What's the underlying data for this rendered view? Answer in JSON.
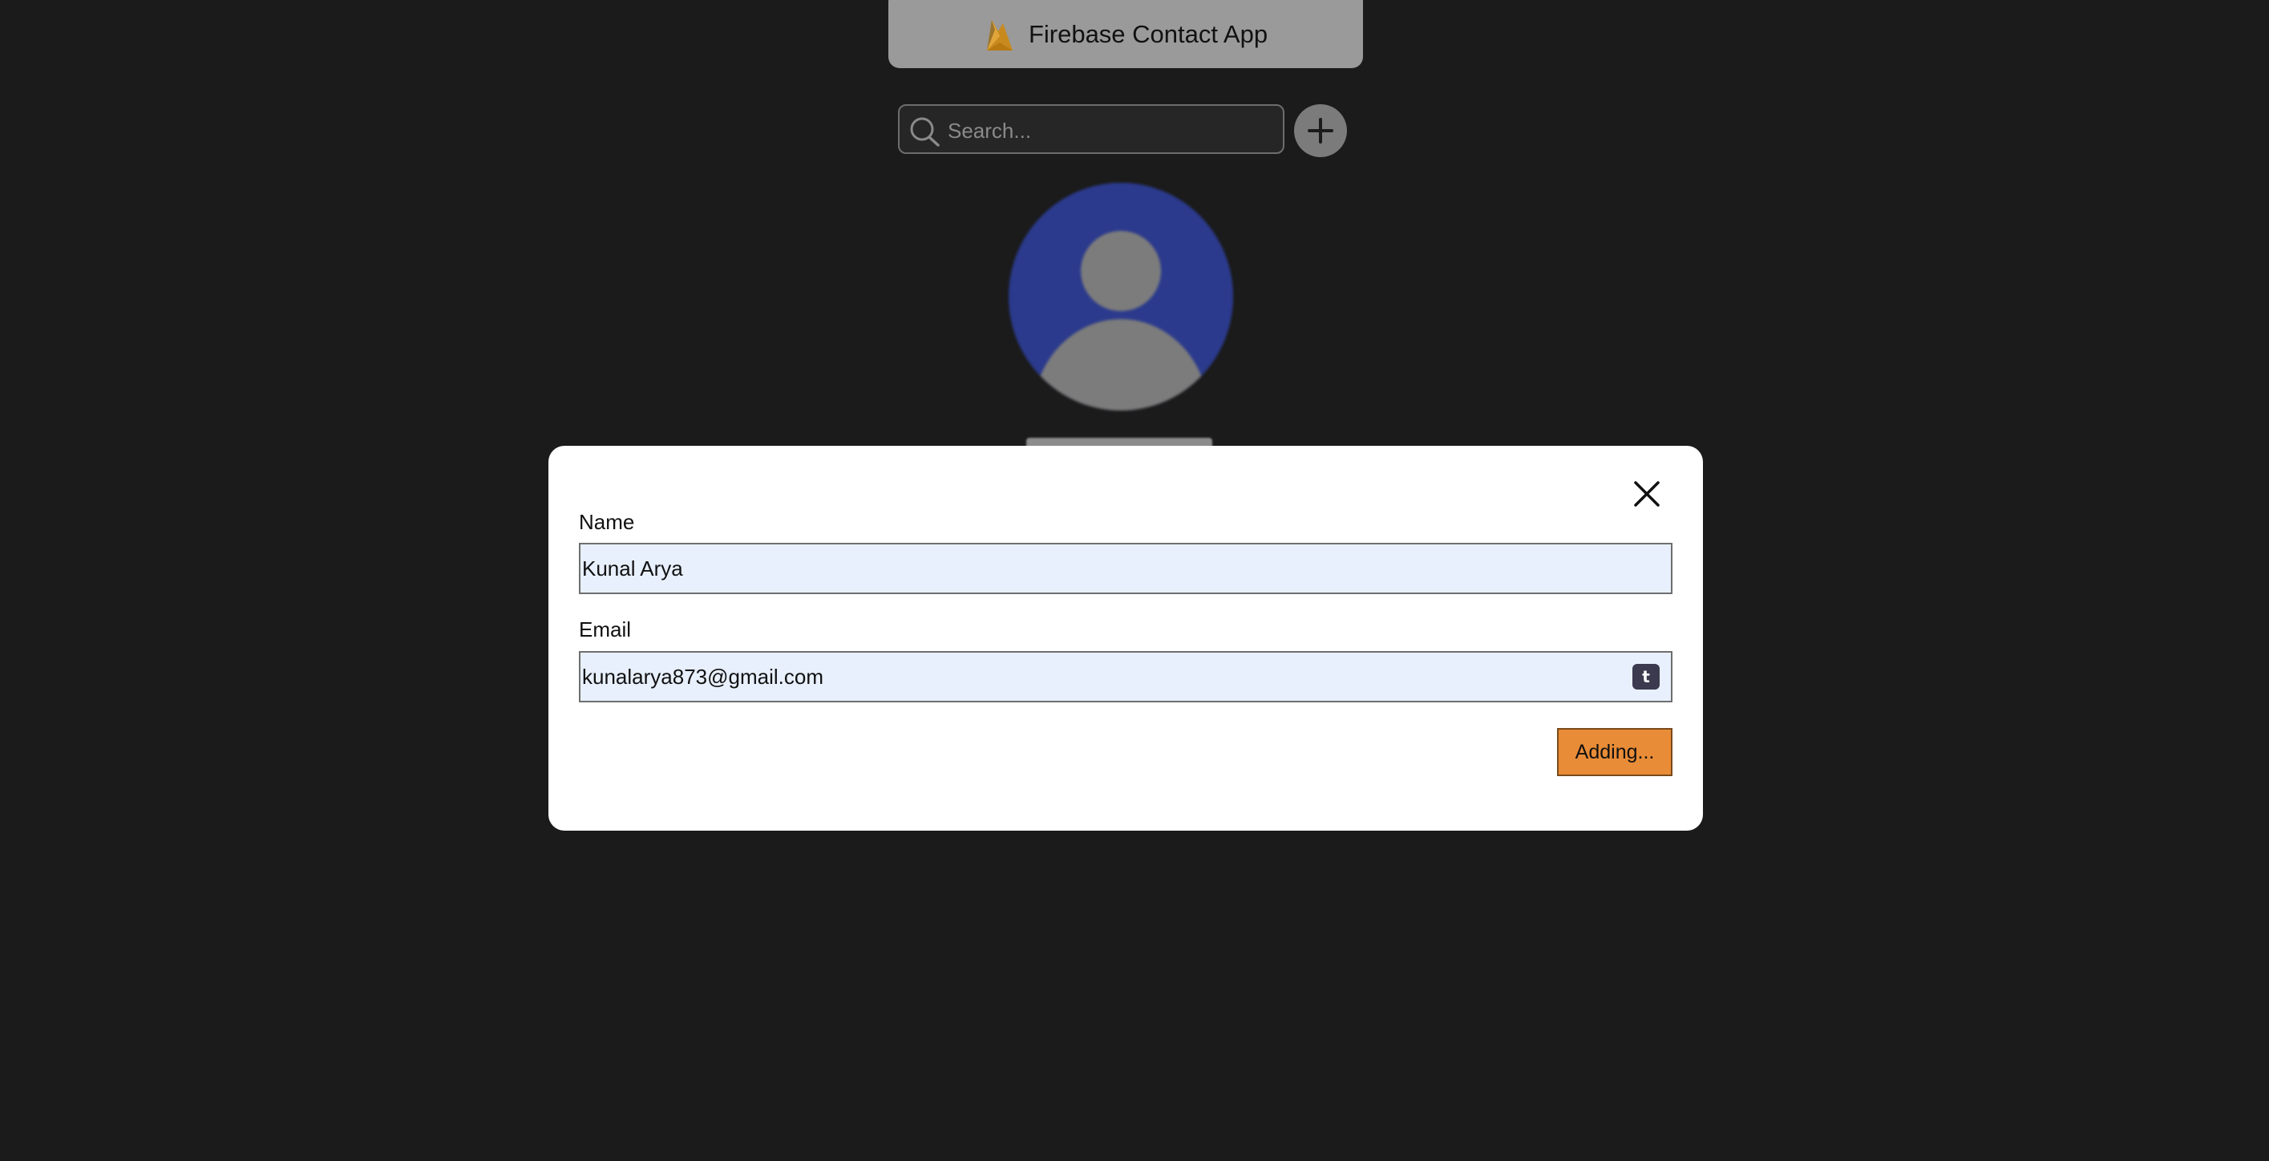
{
  "app": {
    "title": "Firebase Contact App",
    "logo_icon": "firebase-logo-icon"
  },
  "search": {
    "placeholder": "Search...",
    "value": "",
    "icon": "search-icon"
  },
  "add_button": {
    "icon": "plus-icon"
  },
  "modal": {
    "close_icon": "close-icon",
    "name_label": "Name",
    "name_value": "Kunal Arya",
    "email_label": "Email",
    "email_value": "kunalarya873@gmail.com",
    "email_badge": "t",
    "submit_label": "Adding..."
  },
  "colors": {
    "background": "#1b1b1b",
    "navbar": "#9a9a9a",
    "modal": "#ffffff",
    "input_fill": "#e8f0fe",
    "submit_button": "#e98c37",
    "avatar_background": "#2b3a8c"
  }
}
